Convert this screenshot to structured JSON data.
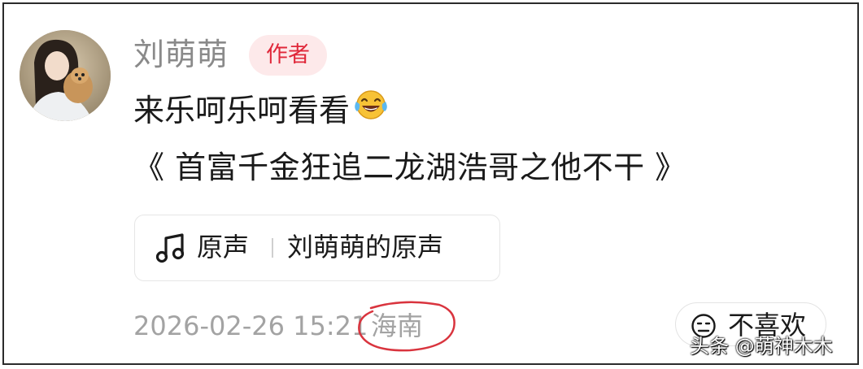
{
  "comment": {
    "username": "刘萌萌",
    "author_badge": "作者",
    "text_line1": "来乐呵乐呵看看",
    "emoji": "laughing-tears-emoji",
    "text_line2": "《 首富千金狂追二龙湖浩哥之他不干 》"
  },
  "music": {
    "label": "原声",
    "title": "刘萌萌的原声"
  },
  "meta": {
    "timestamp": "2026-02-26 15:21",
    "location": "海南"
  },
  "actions": {
    "dislike_label": "不喜欢"
  },
  "watermark": {
    "text": "头条 @萌神木木"
  },
  "colors": {
    "username": "#8a8a8a",
    "badge_text": "#e0283a",
    "badge_bg": "#fde9ea",
    "meta_text": "#a3a3a3",
    "annotation_circle": "#d9343e"
  }
}
